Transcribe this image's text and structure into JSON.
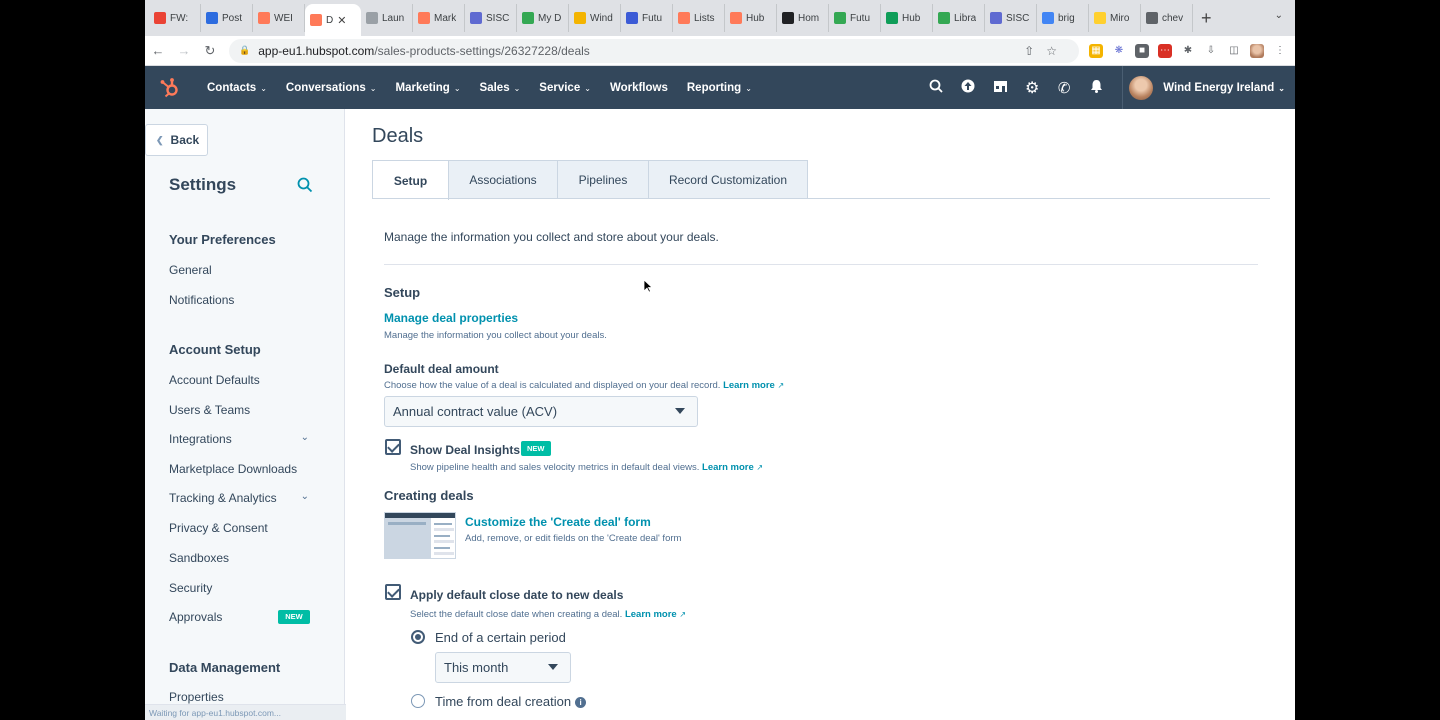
{
  "browser": {
    "tabs": [
      {
        "label": "FW:",
        "icon": "gmail-icon",
        "color": "#ea4335"
      },
      {
        "label": "Post",
        "icon": "zoho-icon",
        "color": "#2d6cdf"
      },
      {
        "label": "WEI",
        "icon": "hubspot-icon",
        "color": "#ff7a59"
      },
      {
        "label": "D",
        "icon": "hubspot-icon",
        "color": "#ff7a59",
        "active": true
      },
      {
        "label": "Laun",
        "icon": "globe-icon",
        "color": "#9aa0a6"
      },
      {
        "label": "Mark",
        "icon": "hubspot-icon",
        "color": "#ff7a59"
      },
      {
        "label": "SISC",
        "icon": "gear-icon",
        "color": "#5f6ad1"
      },
      {
        "label": "My D",
        "icon": "drive-icon",
        "color": "#34a853"
      },
      {
        "label": "Wind",
        "icon": "slides-icon",
        "color": "#f4b400"
      },
      {
        "label": "Futu",
        "icon": "forms-icon",
        "color": "#3c5bd6"
      },
      {
        "label": "Lists",
        "icon": "hubspot-icon",
        "color": "#ff7a59"
      },
      {
        "label": "Hub",
        "icon": "hubspot-icon",
        "color": "#ff7a59"
      },
      {
        "label": "Hom",
        "icon": "clock-icon",
        "color": "#202124"
      },
      {
        "label": "Futu",
        "icon": "drive-icon",
        "color": "#34a853"
      },
      {
        "label": "Hub",
        "icon": "sheets-icon",
        "color": "#0f9d58"
      },
      {
        "label": "Libra",
        "icon": "drive-icon",
        "color": "#34a853"
      },
      {
        "label": "SISC",
        "icon": "gear-icon",
        "color": "#5f6ad1"
      },
      {
        "label": "brig",
        "icon": "docs-icon",
        "color": "#4285f4"
      },
      {
        "label": "Miro",
        "icon": "miro-icon",
        "color": "#ffd02f"
      },
      {
        "label": "chev",
        "icon": "google-icon",
        "color": "#5f6368"
      }
    ],
    "url_host": "app-eu1.hubspot.com",
    "url_path": "/sales-products-settings/26327228/deals",
    "status": "Waiting for app-eu1.hubspot.com..."
  },
  "nav": {
    "items": [
      {
        "label": "Contacts",
        "dropdown": true
      },
      {
        "label": "Conversations",
        "dropdown": true
      },
      {
        "label": "Marketing",
        "dropdown": true
      },
      {
        "label": "Sales",
        "dropdown": true
      },
      {
        "label": "Service",
        "dropdown": true
      },
      {
        "label": "Workflows",
        "dropdown": false
      },
      {
        "label": "Reporting",
        "dropdown": true
      }
    ],
    "account": "Wind Energy Ireland"
  },
  "sidebar": {
    "back": "Back",
    "title": "Settings",
    "groups": [
      {
        "title": "Your Preferences",
        "items": [
          "General",
          "Notifications"
        ]
      },
      {
        "title": "Account Setup",
        "items": [
          "Account Defaults",
          "Users & Teams",
          "Integrations",
          "Marketplace Downloads",
          "Tracking & Analytics",
          "Privacy & Consent",
          "Sandboxes",
          "Security",
          "Approvals"
        ]
      },
      {
        "title": "Data Management",
        "items": [
          "Properties"
        ]
      }
    ],
    "new_badge": "NEW"
  },
  "main": {
    "title": "Deals",
    "tabs": [
      "Setup",
      "Associations",
      "Pipelines",
      "Record Customization"
    ],
    "intro": "Manage the information you collect and store about your deals.",
    "setup": {
      "heading": "Setup",
      "manage_link": "Manage deal properties",
      "manage_help": "Manage the information you collect about your deals.",
      "amount_label": "Default deal amount",
      "amount_help": "Choose how the value of a deal is calculated and displayed on your deal record.",
      "learn_more": "Learn more",
      "amount_value": "Annual contract value (ACV)",
      "insights_label": "Show Deal Insights",
      "insights_badge": "NEW",
      "insights_help": "Show pipeline health and sales velocity metrics in default deal views."
    },
    "creating": {
      "heading": "Creating deals",
      "form_link": "Customize the 'Create deal' form",
      "form_help": "Add, remove, or edit fields on the 'Create deal' form",
      "close_label": "Apply default close date to new deals",
      "close_help": "Select the default close date when creating a deal.",
      "option1": "End of a certain period",
      "period_value": "This month",
      "option2": "Time from deal creation"
    }
  }
}
